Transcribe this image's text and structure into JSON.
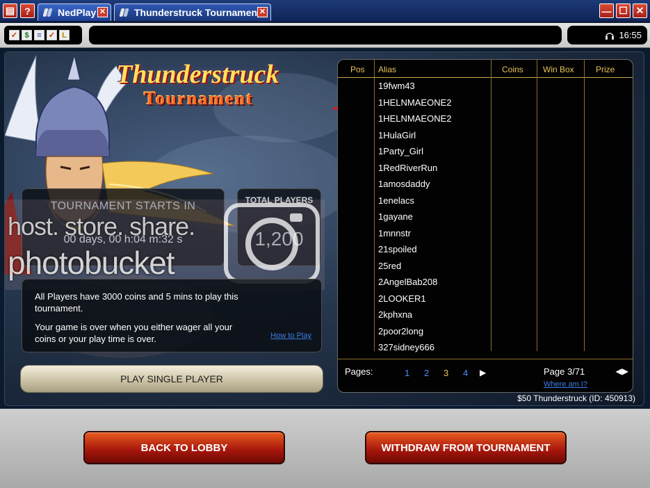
{
  "window": {
    "tabs": [
      {
        "label": "NedPlay",
        "close": "✕"
      },
      {
        "label": "Thunderstruck Tournament",
        "close": "✕"
      }
    ],
    "left_buttons": [
      "▤",
      "?"
    ],
    "right_buttons": [
      "—",
      "☐",
      "✕"
    ]
  },
  "toolbar": {
    "icons": [
      "✓",
      "$",
      "≡",
      "✓",
      "L"
    ],
    "time": "16:55"
  },
  "logo": {
    "line1": "Thunderstruck",
    "line2": "Tournament"
  },
  "watermark": {
    "line1": "host. store. share.",
    "line2": "photobucket"
  },
  "tournament": {
    "starts_label": "TOURNAMENT STARTS IN",
    "countdown": "00 days, 00 h:04 m:32 s",
    "total_label": "TOTAL PLAYERS",
    "total_value": "1,200",
    "info_1": "All Players have 3000 coins and 5 mins to play this tournament.",
    "info_2": "Your game is over when you either wager all your coins or your play time is over.",
    "how_to_play": "How to Play",
    "play_button": "PLAY SINGLE PLAYER",
    "id_text": "$50 Thunderstruck (ID: 450913)"
  },
  "player_list": {
    "headers": {
      "pos": "Pos",
      "alias": "Alias",
      "coins": "Coins",
      "winbox": "Win Box",
      "prize": "Prize"
    },
    "aliases": [
      "19fwm43",
      "1HELNMAEONE2",
      "1HELNMAEONE2",
      "1HulaGirl",
      "1Party_Girl",
      "1RedRiverRun",
      "1amosdaddy",
      "1enelacs",
      "1gayane",
      "1mnnstr",
      "21spoiled",
      "25red",
      "2AngelBab208",
      "2LOOKER1",
      "2kphxna",
      "2poor2long",
      "327sidney666"
    ],
    "pager": {
      "label": "Pages:",
      "pages": [
        "1",
        "2",
        "3",
        "4"
      ],
      "current": "3",
      "next": "▶",
      "page_info": "Page 3/71",
      "where": "Where am I?",
      "nav": "◀▶"
    }
  },
  "bottom": {
    "back": "BACK TO LOBBY",
    "withdraw": "WITHDRAW FROM TOURNAMENT"
  }
}
